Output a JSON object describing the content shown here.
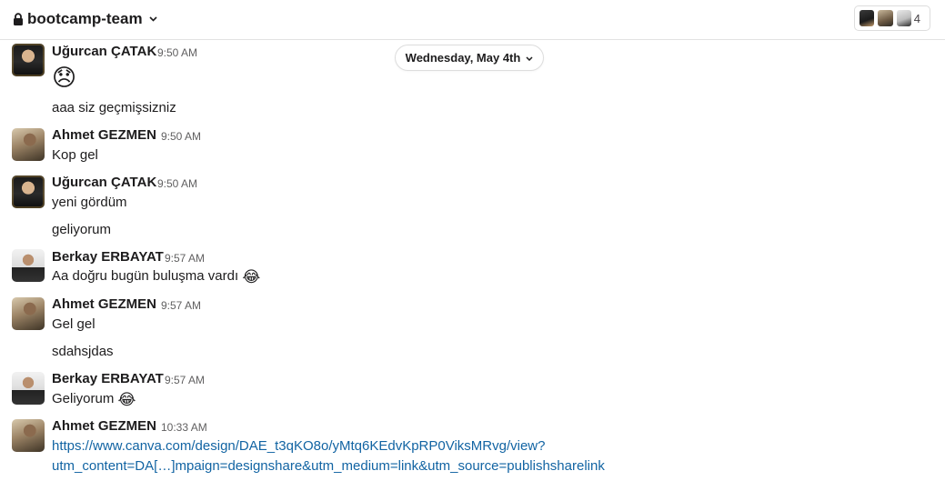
{
  "header": {
    "channel_name": "bootcamp-team",
    "member_count": "4"
  },
  "date_divider": "Wednesday, May 4th",
  "messages": [
    {
      "sender": "Uğurcan ÇATAK",
      "time": "9:50 AM",
      "lines": [
        "😞",
        "aaa siz geçmişsizniz"
      ]
    },
    {
      "sender": "Ahmet GEZMEN",
      "time": "9:50 AM",
      "lines": [
        "Kop gel"
      ]
    },
    {
      "sender": "Uğurcan ÇATAK",
      "time": "9:50 AM",
      "lines": [
        "yeni gördüm",
        "geliyorum"
      ]
    },
    {
      "sender": "Berkay ERBAYAT",
      "time": "9:57 AM",
      "lines": [
        "Aa doğru bugün buluşma vardı",
        "😂"
      ]
    },
    {
      "sender": "Ahmet GEZMEN",
      "time": "9:57 AM",
      "lines": [
        "Gel gel",
        "sdahsjdas"
      ]
    },
    {
      "sender": "Berkay ERBAYAT",
      "time": "9:57 AM",
      "lines": [
        "Geliyorum",
        "😂"
      ]
    },
    {
      "sender": "Ahmet GEZMEN",
      "time": "10:33 AM",
      "lines": [
        "https://www.canva.com/design/DAE_t3qKO8o/yMtq6KEdvKpRP0ViksMRvg/view?",
        "utm_content=DA[…]mpaign=designshare&utm_medium=link&utm_source=publishsharelink"
      ]
    }
  ],
  "icons": {
    "lock": "lock-icon",
    "chevron": "chevron-down-icon"
  },
  "colors": {
    "link": "#1264a3",
    "text": "#1d1c1d",
    "muted": "#616061"
  }
}
